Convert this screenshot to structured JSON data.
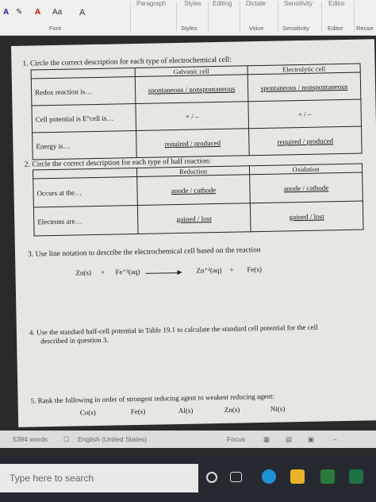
{
  "ribbon": {
    "groups": [
      "Paragraph",
      "Styles",
      "Editing",
      "Dictate",
      "Sensitivity",
      "Editor"
    ],
    "bottom": [
      "Font",
      "Styles",
      "Voice",
      "Sensitivity",
      "Editor",
      "Reuse"
    ],
    "font_tools": [
      "A",
      "Aa",
      "A",
      "A"
    ]
  },
  "q1": {
    "prompt": "1.  Circle the correct description for each type of electrochemical cell:",
    "headers": [
      "",
      "Galvanic cell",
      "Electrolytic cell"
    ],
    "rows": [
      {
        "label": "Redox reaction is…",
        "galvanic": "spontaneous  /  nonspontaneous",
        "electrolytic": "spontaneous  /  nonspontaneous"
      },
      {
        "label": "Cell potential is E°cell is…",
        "galvanic": "+ / –",
        "electrolytic": "+ / –"
      },
      {
        "label": "Energy is…",
        "galvanic": "required  /  produced",
        "electrolytic": "required  /  produced"
      }
    ]
  },
  "q2": {
    "prompt": "2.  Circle the correct description for each type of half reaction:",
    "headers": [
      "",
      "Reduction",
      "Oxidation"
    ],
    "rows": [
      {
        "label": "Occurs at the…",
        "reduction": "anode  /  cathode",
        "oxidation": "anode  /  cathode"
      },
      {
        "label": "Electrons are…",
        "reduction": "gained  /  lost",
        "oxidation": "gained  /  lost"
      }
    ]
  },
  "q3": {
    "prompt": "3.  Use line notation to describe the electrochemical cell based on the reaction",
    "reaction": {
      "r1": "Zn(s)",
      "plus1": "+",
      "r2": "Fe⁺²(aq)",
      "p1": "Zn⁺²(aq)",
      "plus2": "+",
      "p2": "Fe(s)"
    }
  },
  "q4": {
    "line1": "4.  Use the standard half-cell potential in Table 19.1 to calculate the standard cell potential for the cell",
    "line2": "described in question 3."
  },
  "q5": {
    "prompt": "5.  Rank the following in order of strongest reducing agent to weakest reducing agent:",
    "items": [
      "Co(s)",
      "Fe(s)",
      "Al(s)",
      "Zn(s)",
      "Ni(s)"
    ]
  },
  "status": {
    "words": "5394 words",
    "language": "English (United States)",
    "focus": "Focus"
  },
  "taskbar": {
    "search_placeholder": "Type here to search"
  }
}
